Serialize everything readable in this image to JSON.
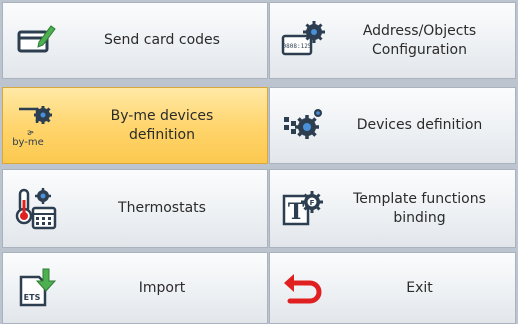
{
  "menu": {
    "send_card_codes": "Send card codes",
    "address_objects": "Address/Objects\nConfiguration",
    "byme_devices": "By-me devices\ndefinition",
    "devices_definition": "Devices definition",
    "thermostats": "Thermostats",
    "template_functions": "Template functions\nbinding",
    "import": "Import",
    "exit": "Exit"
  },
  "icons": {
    "send_card_codes": "card-pen-icon",
    "address_objects": "address-gear-icon",
    "byme_devices": "byme-gear-icon",
    "devices_definition": "devices-gear-icon",
    "thermostats": "thermometer-calendar-icon",
    "template_functions": "template-gear-icon",
    "import": "ets-import-icon",
    "exit": "exit-arrow-icon"
  },
  "icon_text": {
    "address": "0808:125",
    "byme": "by-me",
    "ets": "ETS"
  },
  "state": {
    "active_item": "byme_devices"
  },
  "colors": {
    "active_tile": "#ffd46a",
    "accent_green": "#4caf50",
    "exit_red": "#e02020",
    "icon_dark": "#2c3e50"
  }
}
